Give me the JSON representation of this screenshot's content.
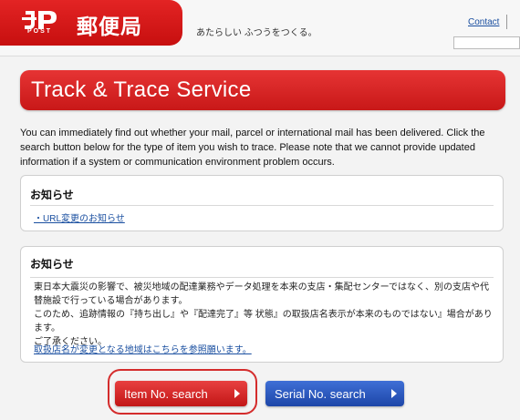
{
  "header": {
    "logo_post": "POST",
    "logo_text": "郵便局",
    "tagline": "あたらしい ふつうをつくる。",
    "contact_label": "Contact",
    "brand_color": "#d11a1a"
  },
  "banner": {
    "title": "Track & Trace Service"
  },
  "intro": {
    "text": "You can immediately find out whether your mail, parcel or international mail has been delivered. Click the search button below for the type of item you wish to trace. Please note that we cannot provide updated information if a system or communication environment problem occurs."
  },
  "notices": [
    {
      "heading": "お知らせ",
      "link": "・URL変更のお知らせ"
    },
    {
      "heading": "お知らせ",
      "body": "東日本大震災の影響で、被災地域の配達業務やデータ処理を本来の支店・集配センターではなく、別の支店や代替施設で行っている場合があります。",
      "body2": "このため、追跡情報の『持ち出し』や『配達完了』等 状態』の取扱店名表示が本来のものではない』場合があります。",
      "body3": "ご了承ください。",
      "link": "取扱店名が変更となる地域はこちらを参照願います。"
    }
  ],
  "buttons": {
    "item_search": "Item No. search",
    "serial_search": "Serial No. search",
    "item_color": "#d42222",
    "serial_color": "#2a55c0"
  }
}
